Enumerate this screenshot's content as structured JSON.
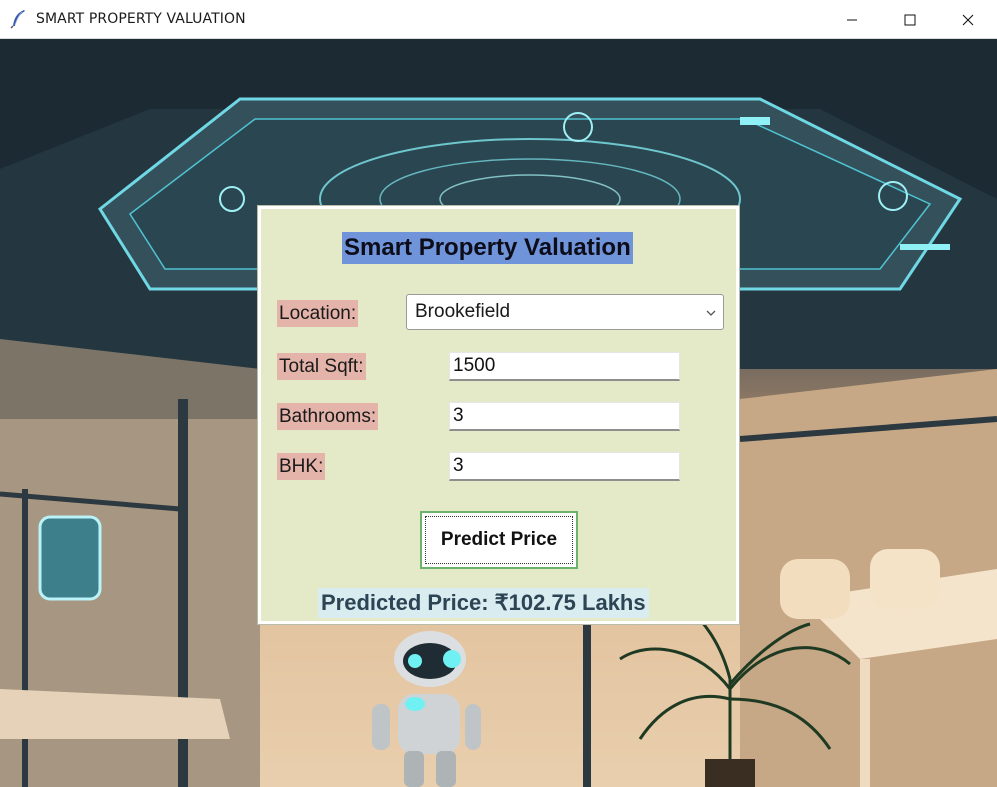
{
  "window": {
    "title": "SMART PROPERTY VALUATION"
  },
  "form": {
    "heading": "Smart Property Valuation",
    "location_label": "Location:",
    "location_value": "Brookefield",
    "sqft_label": "Total Sqft:",
    "sqft_value": "1500",
    "bath_label": "Bathrooms:",
    "bath_value": "3",
    "bhk_label": "BHK:",
    "bhk_value": "3",
    "predict_label": "Predict Price",
    "result_text": "Predicted Price: ₹102.75 Lakhs"
  },
  "icons": {
    "app": "feather-icon",
    "minimize": "minimize-icon",
    "maximize": "maximize-icon",
    "close": "close-icon",
    "dropdown": "chevron-down-icon"
  },
  "colors": {
    "panel_bg": "#e4e9c8",
    "heading_bg": "#6f94d9",
    "label_bg": "#e4b4ab",
    "button_border": "#6db36d",
    "result_bg": "#d9ecf0"
  }
}
